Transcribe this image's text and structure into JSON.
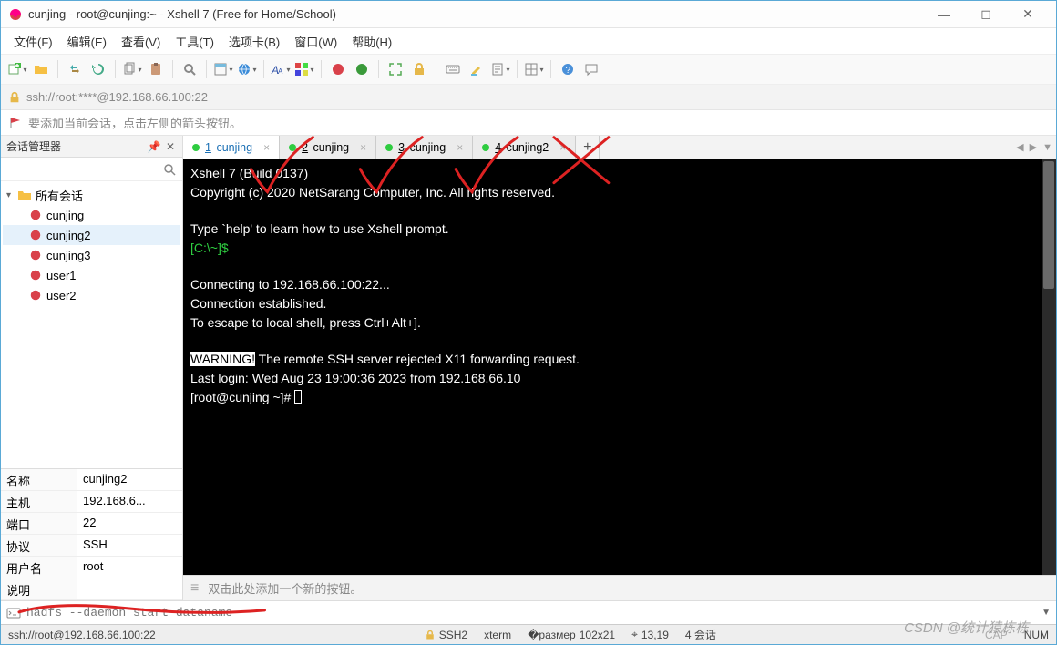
{
  "window": {
    "title": "cunjing - root@cunjing:~ - Xshell 7 (Free for Home/School)"
  },
  "menu": {
    "items": [
      "文件(F)",
      "编辑(E)",
      "查看(V)",
      "工具(T)",
      "选项卡(B)",
      "窗口(W)",
      "帮助(H)"
    ]
  },
  "addressbar": {
    "url": "ssh://root:****@192.168.66.100:22"
  },
  "hint": {
    "text": "要添加当前会话，点击左侧的箭头按钮。"
  },
  "sidebar": {
    "title": "会话管理器",
    "root": "所有会话",
    "items": [
      "cunjing",
      "cunjing2",
      "cunjing3",
      "user1",
      "user2"
    ],
    "props": {
      "labels": {
        "name": "名称",
        "host": "主机",
        "port": "端口",
        "proto": "协议",
        "user": "用户名",
        "desc": "说明"
      },
      "values": {
        "name": "cunjing2",
        "host": "192.168.6...",
        "port": "22",
        "proto": "SSH",
        "user": "root",
        "desc": ""
      }
    }
  },
  "tabs": [
    {
      "num": "1",
      "label": "cunjing",
      "active": true
    },
    {
      "num": "2",
      "label": "cunjing",
      "active": false
    },
    {
      "num": "3",
      "label": "cunjing",
      "active": false
    },
    {
      "num": "4",
      "label": "cunjing2",
      "active": false
    }
  ],
  "terminal": {
    "l1": "Xshell 7 (Build 0137)",
    "l2": "Copyright (c) 2020 NetSarang Computer, Inc. All rights reserved.",
    "l3": "Type `help' to learn how to use Xshell prompt.",
    "l4": "[C:\\~]$",
    "l5": "Connecting to 192.168.66.100:22...",
    "l6": "Connection established.",
    "l7": "To escape to local shell, press Ctrl+Alt+].",
    "l8a": "WARNING!",
    "l8b": " The remote SSH server rejected X11 forwarding request.",
    "l9": "Last login: Wed Aug 23 19:00:36 2023 from 192.168.66.10",
    "l10": "[root@cunjing ~]# "
  },
  "quickbar": {
    "hint": "双击此处添加一个新的按钮。"
  },
  "cmdbar": {
    "text": "hadfs --daemon  start dataname"
  },
  "status": {
    "conn": "ssh://root@192.168.66.100:22",
    "proto": "SSH2",
    "term": "xterm",
    "size": "102x21",
    "pos": "13,19",
    "sessions": "4 会话",
    "caps": "CAP",
    "num": "NUM"
  },
  "watermark": {
    "text1": "CSDN @统计猿栋栋",
    "text2": "栋栋"
  }
}
